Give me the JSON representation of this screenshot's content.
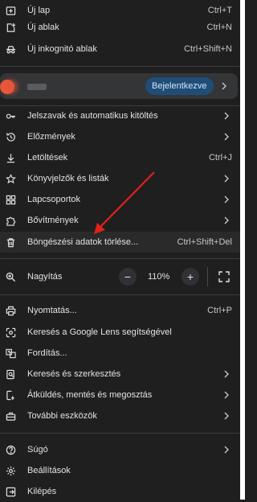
{
  "top_items": [
    {
      "label": "Új lap",
      "shortcut": "Ctrl+T",
      "icon": "new-tab-icon"
    },
    {
      "label": "Új ablak",
      "shortcut": "Ctrl+N",
      "icon": "new-window-icon"
    },
    {
      "label": "Új inkognitó ablak",
      "shortcut": "Ctrl+Shift+N",
      "icon": "incognito-icon"
    }
  ],
  "profile": {
    "signin_label": "Bejelentkezve"
  },
  "mid_items": [
    {
      "label": "Jelszavak és automatikus kitöltés",
      "icon": "key-icon"
    },
    {
      "label": "Előzmények",
      "icon": "history-icon"
    },
    {
      "label": "Letöltések",
      "shortcut": "Ctrl+J",
      "icon": "download-icon"
    },
    {
      "label": "Könyvjelzők és listák",
      "icon": "star-icon"
    },
    {
      "label": "Lapcsoportok",
      "icon": "tab-groups-icon"
    },
    {
      "label": "Bővítmények",
      "icon": "puzzle-icon"
    },
    {
      "label": "Böngészési adatok törlése...",
      "shortcut": "Ctrl+Shift+Del",
      "icon": "trash-icon"
    }
  ],
  "zoom": {
    "label": "Nagyítás",
    "minus": "−",
    "value": "110%",
    "plus": "+"
  },
  "tool_items": [
    {
      "label": "Nyomtatás...",
      "shortcut": "Ctrl+P",
      "icon": "print-icon"
    },
    {
      "label": "Keresés a Google Lens segítségével",
      "icon": "lens-icon"
    },
    {
      "label": "Fordítás...",
      "icon": "translate-icon"
    },
    {
      "label": "Keresés és szerkesztés",
      "icon": "find-edit-icon"
    },
    {
      "label": "Átküldés, mentés és megosztás",
      "icon": "share-icon"
    },
    {
      "label": "További eszközök",
      "icon": "toolbox-icon"
    }
  ],
  "bottom_items": [
    {
      "label": "Súgó",
      "icon": "help-icon"
    },
    {
      "label": "Beállítások",
      "icon": "gear-icon"
    },
    {
      "label": "Kilépés",
      "icon": "exit-icon"
    }
  ],
  "colors": {
    "accent_button": "#1f4d78",
    "annotation_arrow": "#e0211b"
  }
}
